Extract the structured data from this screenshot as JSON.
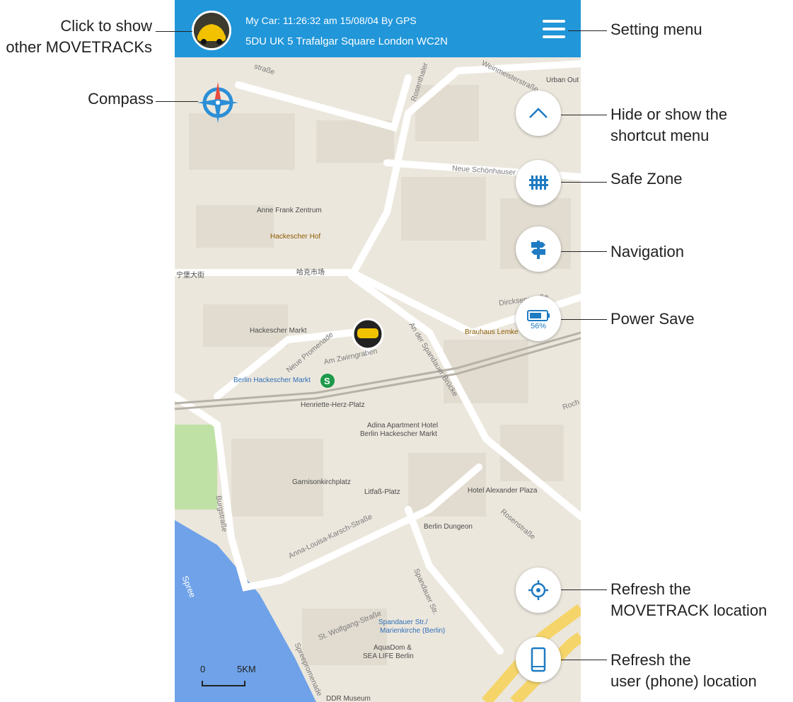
{
  "header": {
    "status_line": "My Car: 11:26:32 am 15/08/04    By GPS",
    "address": "5DU UK 5 Trafalgar Square London WC2N",
    "avatar_icon": "car-avatar-icon",
    "menu_icon": "hamburger-menu-icon"
  },
  "buttons": {
    "shortcut_icon": "chevron-up-icon",
    "safe_zone_icon": "fence-icon",
    "navigation_icon": "signpost-icon",
    "power_save_icon": "battery-icon",
    "battery_percent": "56%",
    "refresh_device_icon": "crosshair-icon",
    "refresh_phone_icon": "phone-icon"
  },
  "map_labels": {
    "strasse_top": "straße",
    "rosenthaler": "Rosenthaler",
    "weinmeister": "Weinmeisterstraße",
    "urban_out": "Urban Out",
    "neue_schoenhauser": "Neue Schönhauser",
    "anne_frank": "Anne Frank Zentrum",
    "hackescher_hof": "Hackescher Hof",
    "chinese_1": "宁堡大街",
    "chinese_2": "哈克市场",
    "dircksen": "Dircksenstraße",
    "hackescher_markt": "Hackescher Markt",
    "brauhaus": "Brauhaus Lemke",
    "neue_promenade": "Neue Promenade",
    "am_zwirngraben": "Am Zwirngraben",
    "an_der_spandauer": "An der Spandauer Brücke",
    "berlin_hackescher_markt": "Berlin Hackescher Markt",
    "henriette": "Henriette-Herz-Platz",
    "adina_1": "Adina Apartment Hotel",
    "adina_2": "Berlin Hackescher Markt",
    "rochstr": "Roch",
    "garnison": "Garnisonkirchplatz",
    "litfass": "Litfaß-Platz",
    "hotel_alex": "Hotel Alexander Plaza",
    "burgstr": "Burgstraße",
    "rosenstr": "Rosenstraße",
    "berlin_dungeon": "Berlin Dungeon",
    "anna_louisa": "Anna-Louisa-Karsch-Straße",
    "spree": "Spree",
    "spandauer_str": "Spandauer Str.",
    "st_wolfgang": "St. Wolfgang-Straße",
    "spandauer_stop_1": "Spandauer Str./",
    "spandauer_stop_2": "Marienkirche (Berlin)",
    "aquadom_1": "AquaDom &",
    "aquadom_2": "SEA LIFE Berlin",
    "spreepromenade": "Spreepromenade",
    "ddr": "DDR Museum"
  },
  "scale": {
    "min": "0",
    "max": "5KM"
  },
  "annotations": {
    "avatar": [
      "Click to show",
      "other MOVETRACKs"
    ],
    "compass": "Compass",
    "setting_menu": "Setting menu",
    "shortcut": [
      "Hide or show the",
      "shortcut menu"
    ],
    "safe_zone": "Safe Zone",
    "navigation": "Navigation",
    "power_save": "Power Save",
    "refresh_device": [
      "Refresh the",
      "MOVETRACK location"
    ],
    "refresh_phone": [
      "Refresh the",
      "user (phone) location"
    ]
  },
  "colors": {
    "header": "#2196d9",
    "accent": "#1f7bc2",
    "map_bg": "#ece7dd",
    "water": "#6fa2e8",
    "park": "#bfe1a5"
  }
}
